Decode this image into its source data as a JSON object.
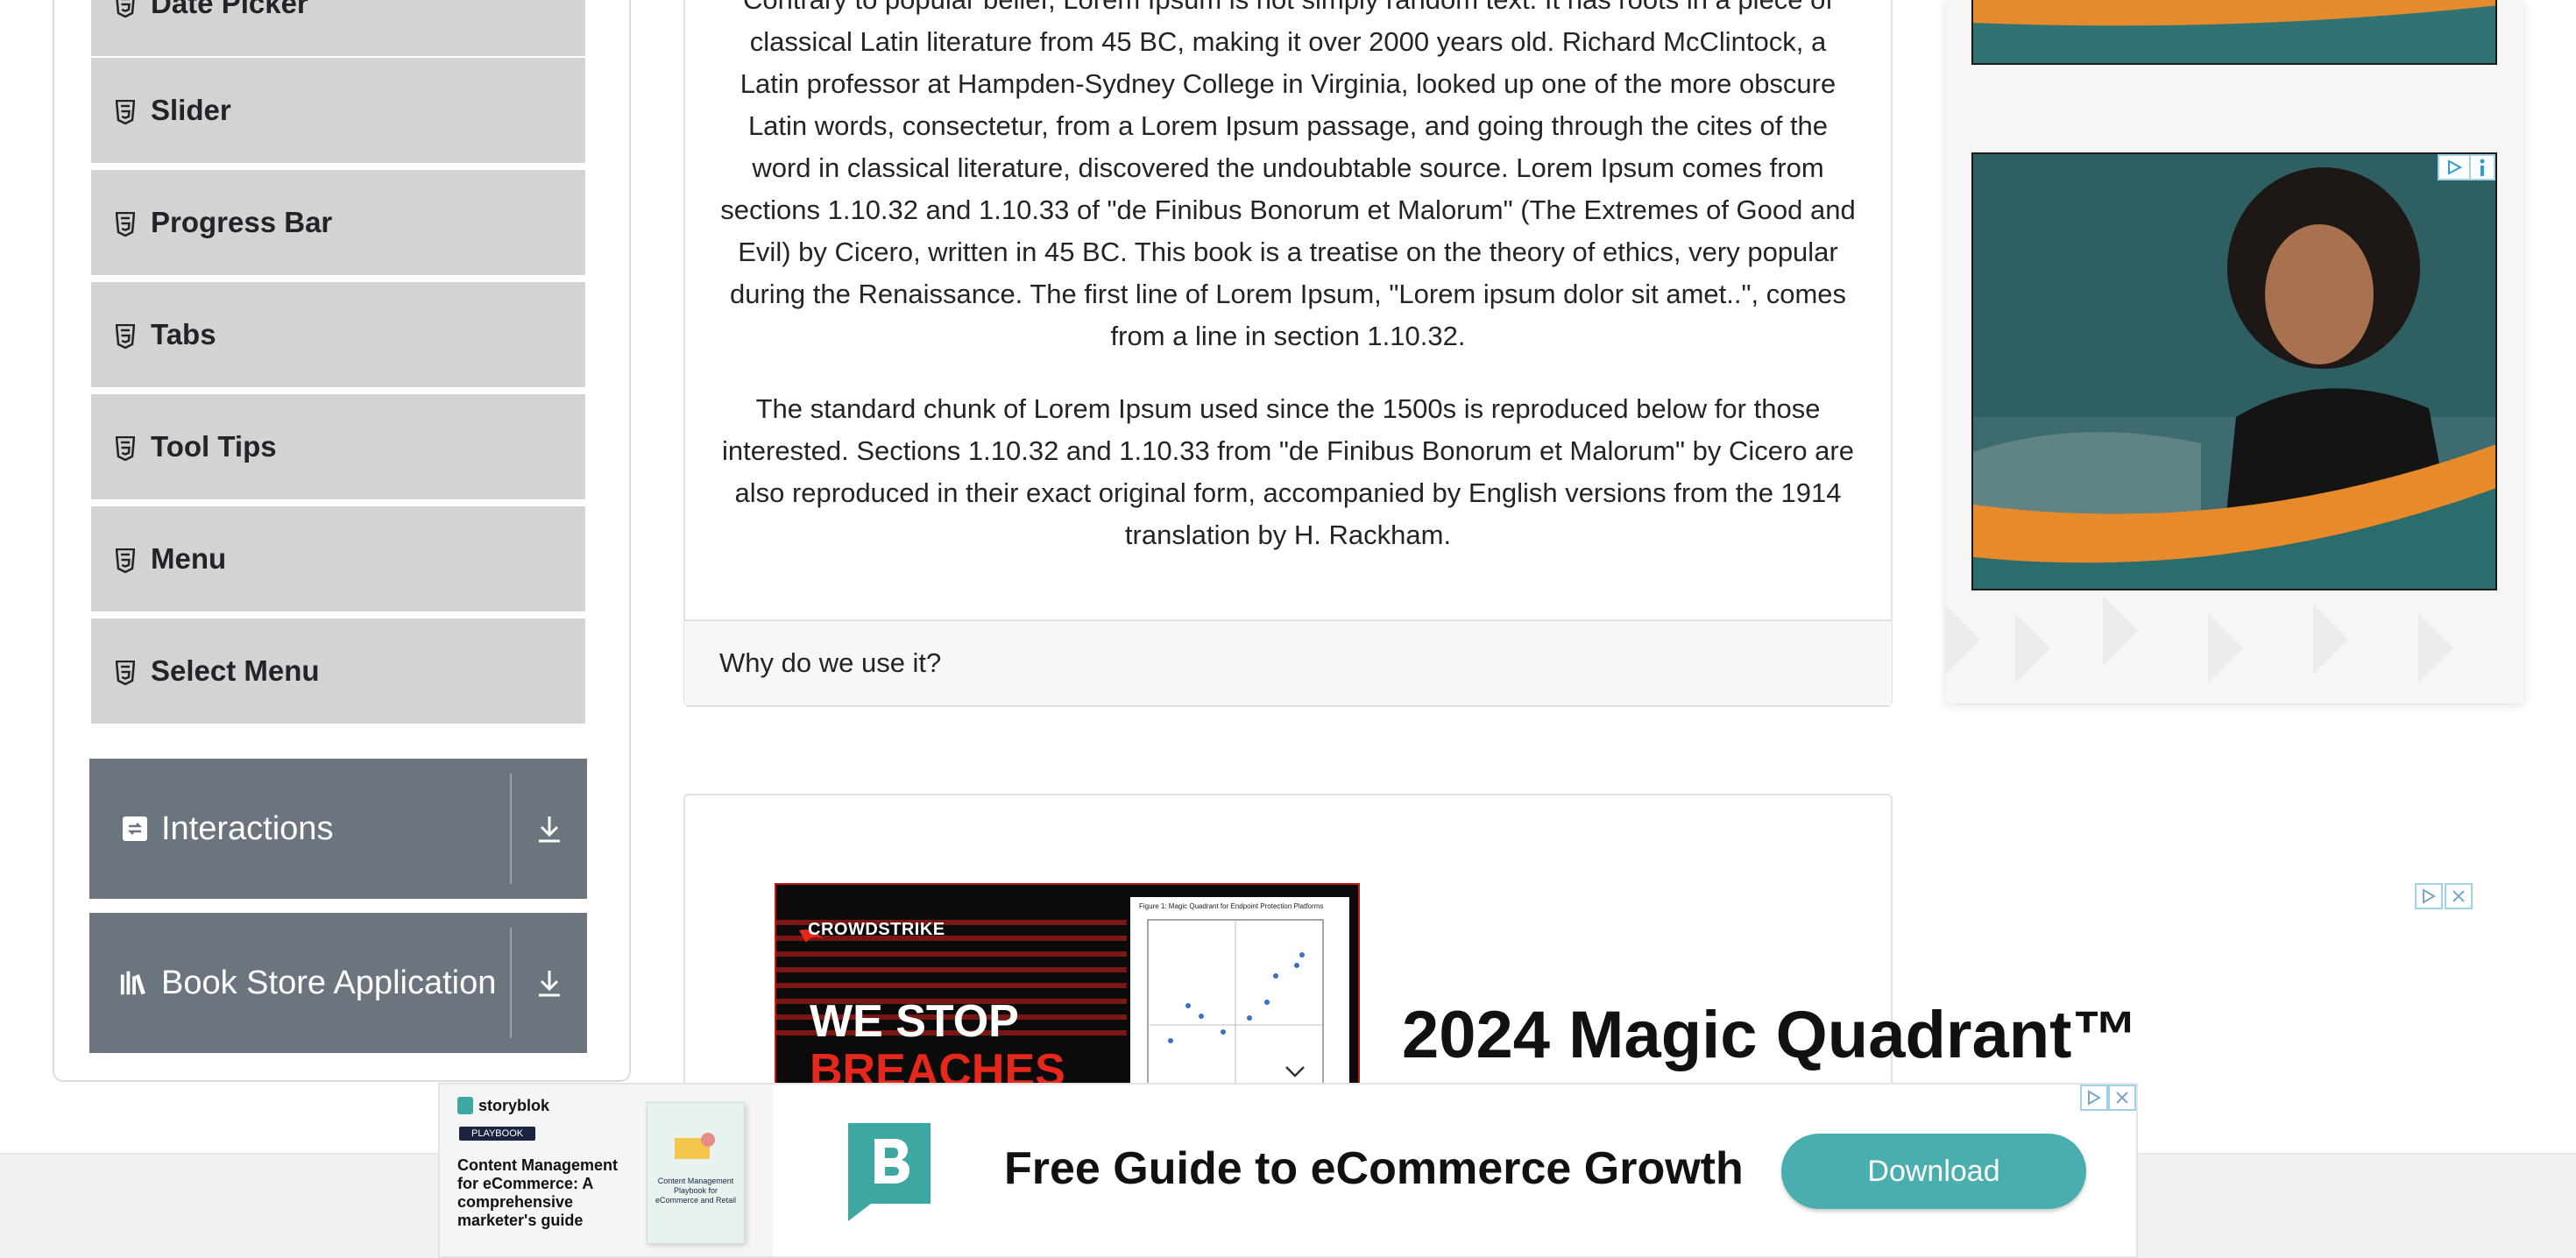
{
  "sidebar": {
    "items": [
      {
        "label": "Date Picker"
      },
      {
        "label": "Slider"
      },
      {
        "label": "Progress Bar"
      },
      {
        "label": "Tabs"
      },
      {
        "label": "Tool Tips"
      },
      {
        "label": "Menu"
      },
      {
        "label": "Select Menu"
      }
    ],
    "groups": [
      {
        "label": "Interactions",
        "icon": "interactions-icon"
      },
      {
        "label": "Book Store Application",
        "icon": "book-store-icon"
      }
    ]
  },
  "main": {
    "paragraph1": "Contrary to popular belief, Lorem Ipsum is not simply random text. It has roots in a piece of classical Latin literature from 45 BC, making it over 2000 years old. Richard McClintock, a Latin professor at Hampden-Sydney College in Virginia, looked up one of the more obscure Latin words, consectetur, from a Lorem Ipsum passage, and going through the cites of the word in classical literature, discovered the undoubtable source. Lorem Ipsum comes from sections 1.10.32 and 1.10.33 of \"de Finibus Bonorum et Malorum\" (The Extremes of Good and Evil) by Cicero, written in 45 BC. This book is a treatise on the theory of ethics, very popular during the Renaissance. The first line of Lorem Ipsum, \"Lorem ipsum dolor sit amet..\", comes from a line in section 1.10.32.",
    "paragraph2": "The standard chunk of Lorem Ipsum used since the 1500s is reproduced below for those interested. Sections 1.10.32 and 1.10.33 from \"de Finibus Bonorum et Malorum\" by Cicero are also reproduced in their exact original form, accompanied by English versions from the 1914 translation by H. Rackham.",
    "accordion_next": "Why do we use it?"
  },
  "ads": {
    "crowdstrike": {
      "brand": "CROWDSTRIKE",
      "headline1": "WE STOP",
      "headline2": "BREACHES",
      "figure_caption": "Figure 1: Magic Quadrant for Endpoint Protection Platforms",
      "title": "2024 Magic Quadrant™"
    },
    "storyblok": {
      "brand": "storyblok",
      "badge": "PLAYBOOK",
      "description": "Content Management for eCommerce: A comprehensive marketer's guide",
      "cover_text": "Content Management Playbook for eCommerce and Retail",
      "headline": "Free Guide to eCommerce Growth",
      "cta": "Download"
    }
  },
  "colors": {
    "menu_item_bg": "#d3d3d3",
    "group_header_bg": "#6c757d",
    "download_btn": "#4aaeae",
    "storyblok_teal": "#3fa7a2"
  }
}
